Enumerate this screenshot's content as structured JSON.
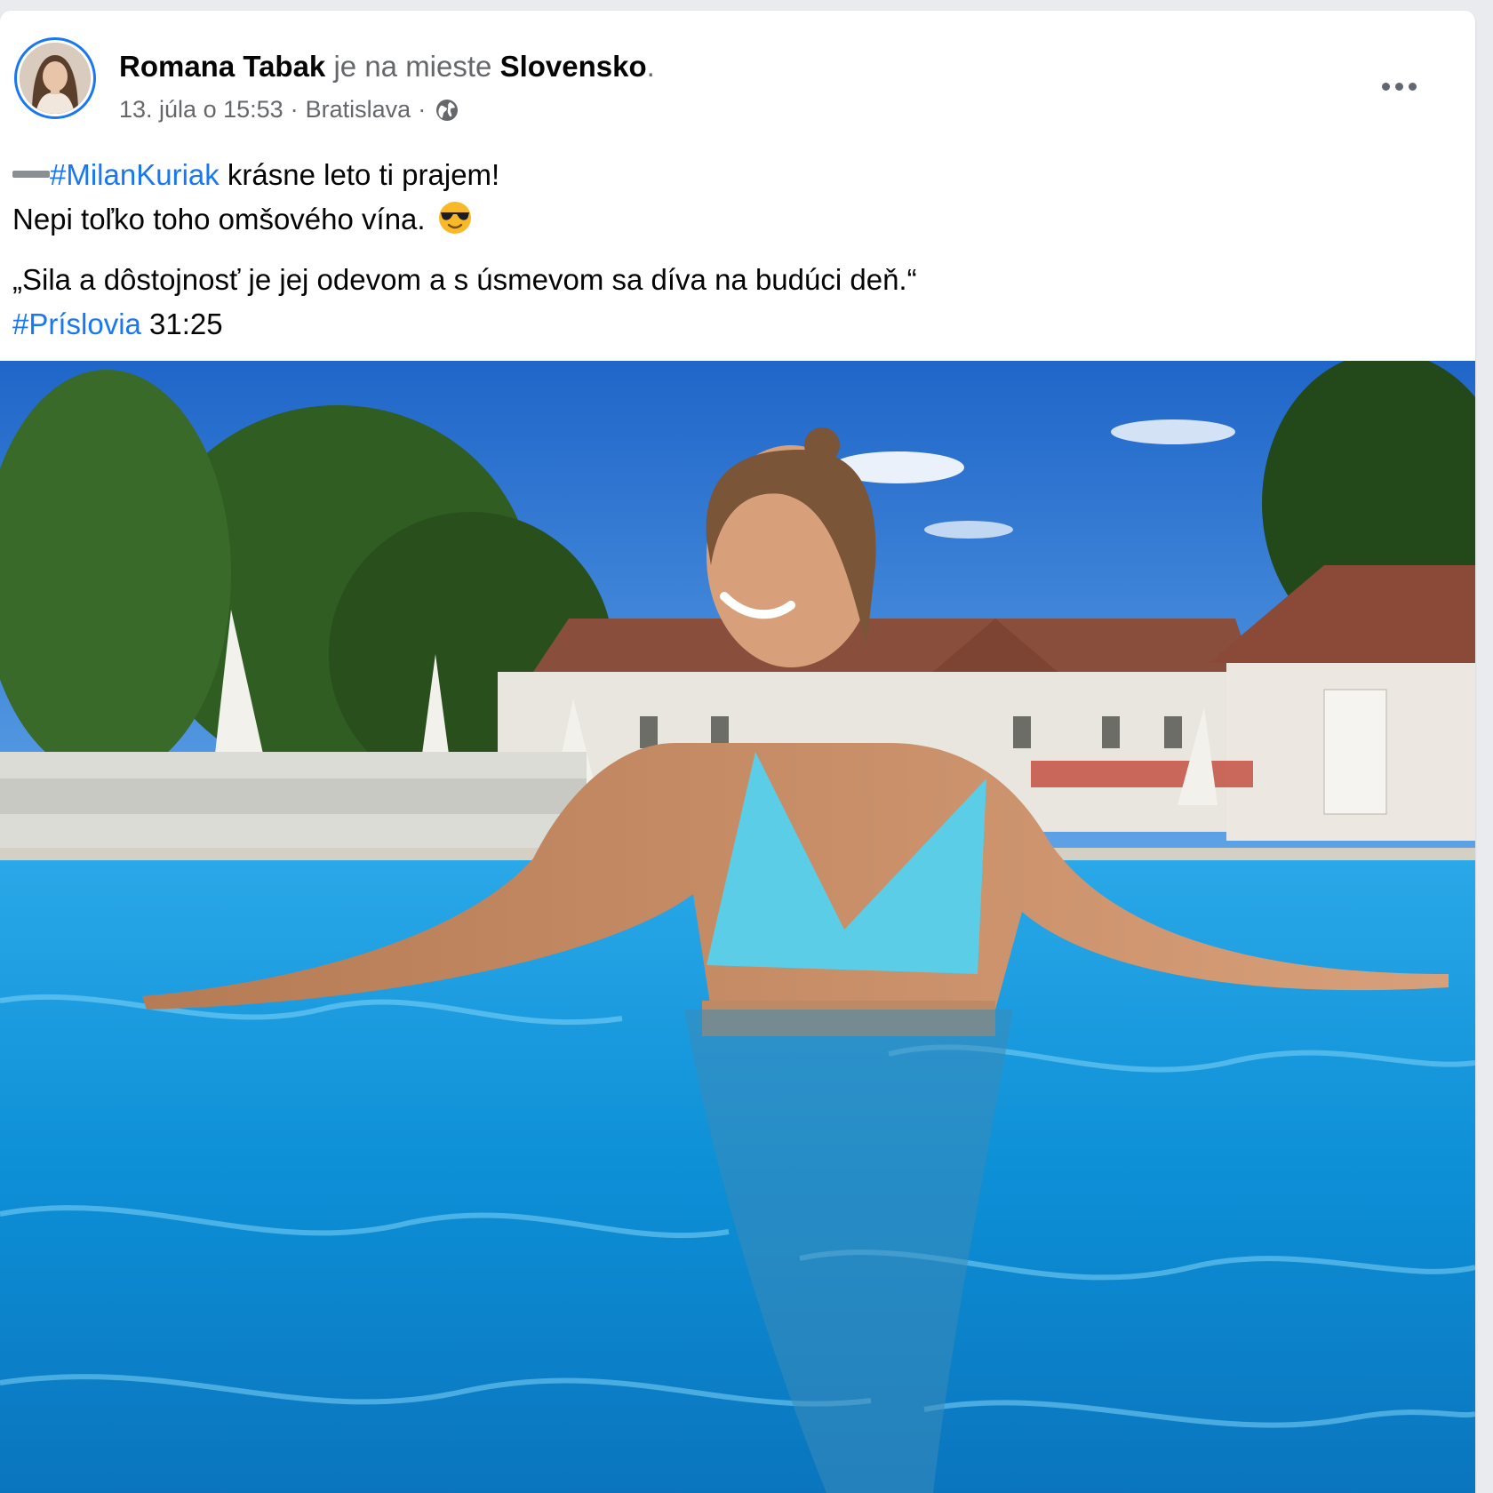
{
  "post": {
    "author": "Romana Tabak",
    "checkin_prefix": "je na mieste",
    "place": "Slovensko",
    "place_suffix": ".",
    "timestamp": "13. júla o 15:53",
    "separator": "·",
    "location": "Bratislava",
    "privacy_icon": "globe-icon",
    "more_icon": "more-options-icon",
    "text": {
      "line1_hashtag": "#MilanKuriak",
      "line1_rest": " krásne leto ti prajem!",
      "line2": "Nepi toľko toho omšového vína.",
      "line2_emoji": "sunglasses-emoji",
      "quote": "„Sila a dôstojnosť je jej odevom a s úsmevom sa díva na budúci deň.“",
      "ref_hashtag": "#Príslovia",
      "ref_rest": " 31:25"
    },
    "photo_icon": "pool-photo"
  },
  "colors": {
    "link": "#1877f2",
    "secondary_text": "#65676b",
    "primary_text": "#050505"
  }
}
